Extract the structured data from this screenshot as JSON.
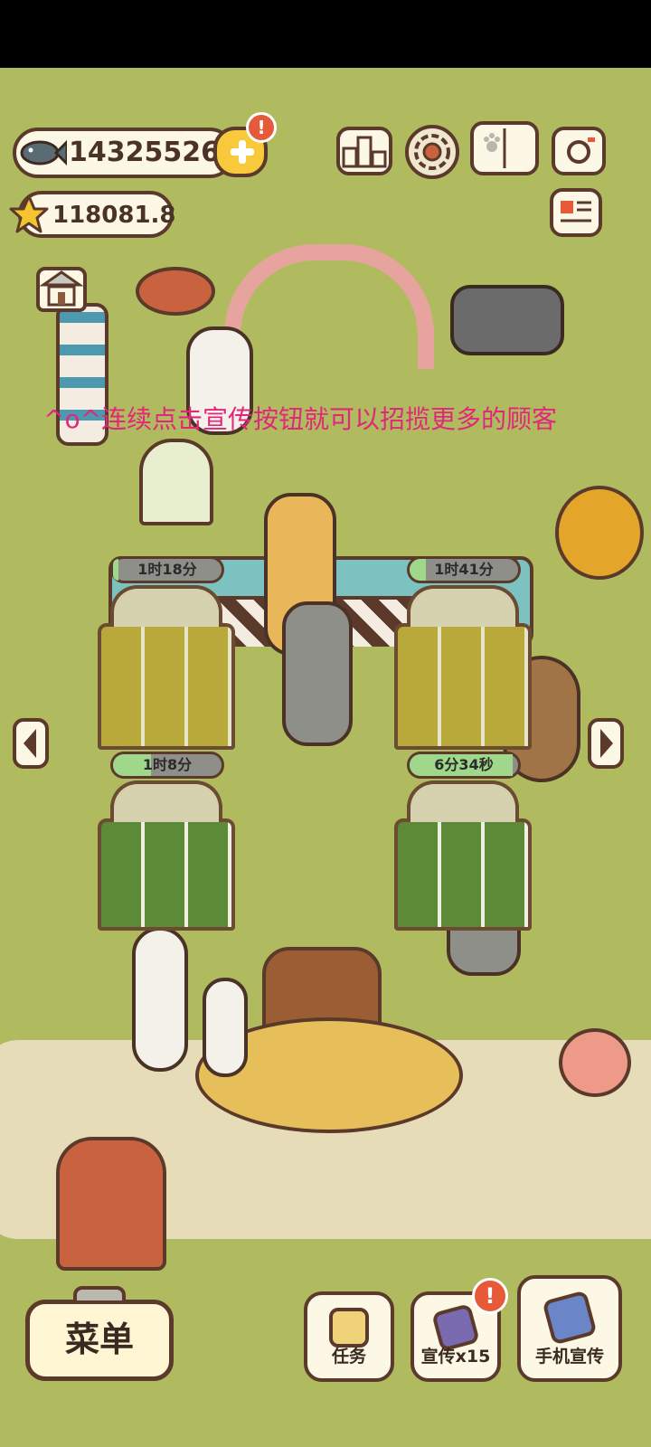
{
  "currency": {
    "fish": "14325526",
    "stars": "118081.8"
  },
  "badges": {
    "plus_alert": "!",
    "promo_alert": "!"
  },
  "top_icons": [
    "ranking-icon",
    "settings-gear-icon",
    "paw-guidebook-icon",
    "camera-icon",
    "news-card-icon"
  ],
  "tip_text": "^o^连续点击宣传按钮就可以招揽更多的顾客",
  "timers": [
    {
      "label": "1时18分",
      "progress": 0.05
    },
    {
      "label": "1时41分",
      "progress": 0.15
    },
    {
      "label": "1时8分",
      "progress": 0.35
    },
    {
      "label": "6分34秒",
      "progress": 0.95
    }
  ],
  "bottom": {
    "menu": "菜单",
    "task": "任务",
    "promo": "宣传x15",
    "phone_promo": "手机宣传"
  },
  "colors": {
    "grass": "#b0bb60",
    "outline": "#5b3a2b",
    "accent_yellow": "#f7c93b",
    "alert_red": "#e65a3a",
    "tip_pink": "#e2267c"
  }
}
